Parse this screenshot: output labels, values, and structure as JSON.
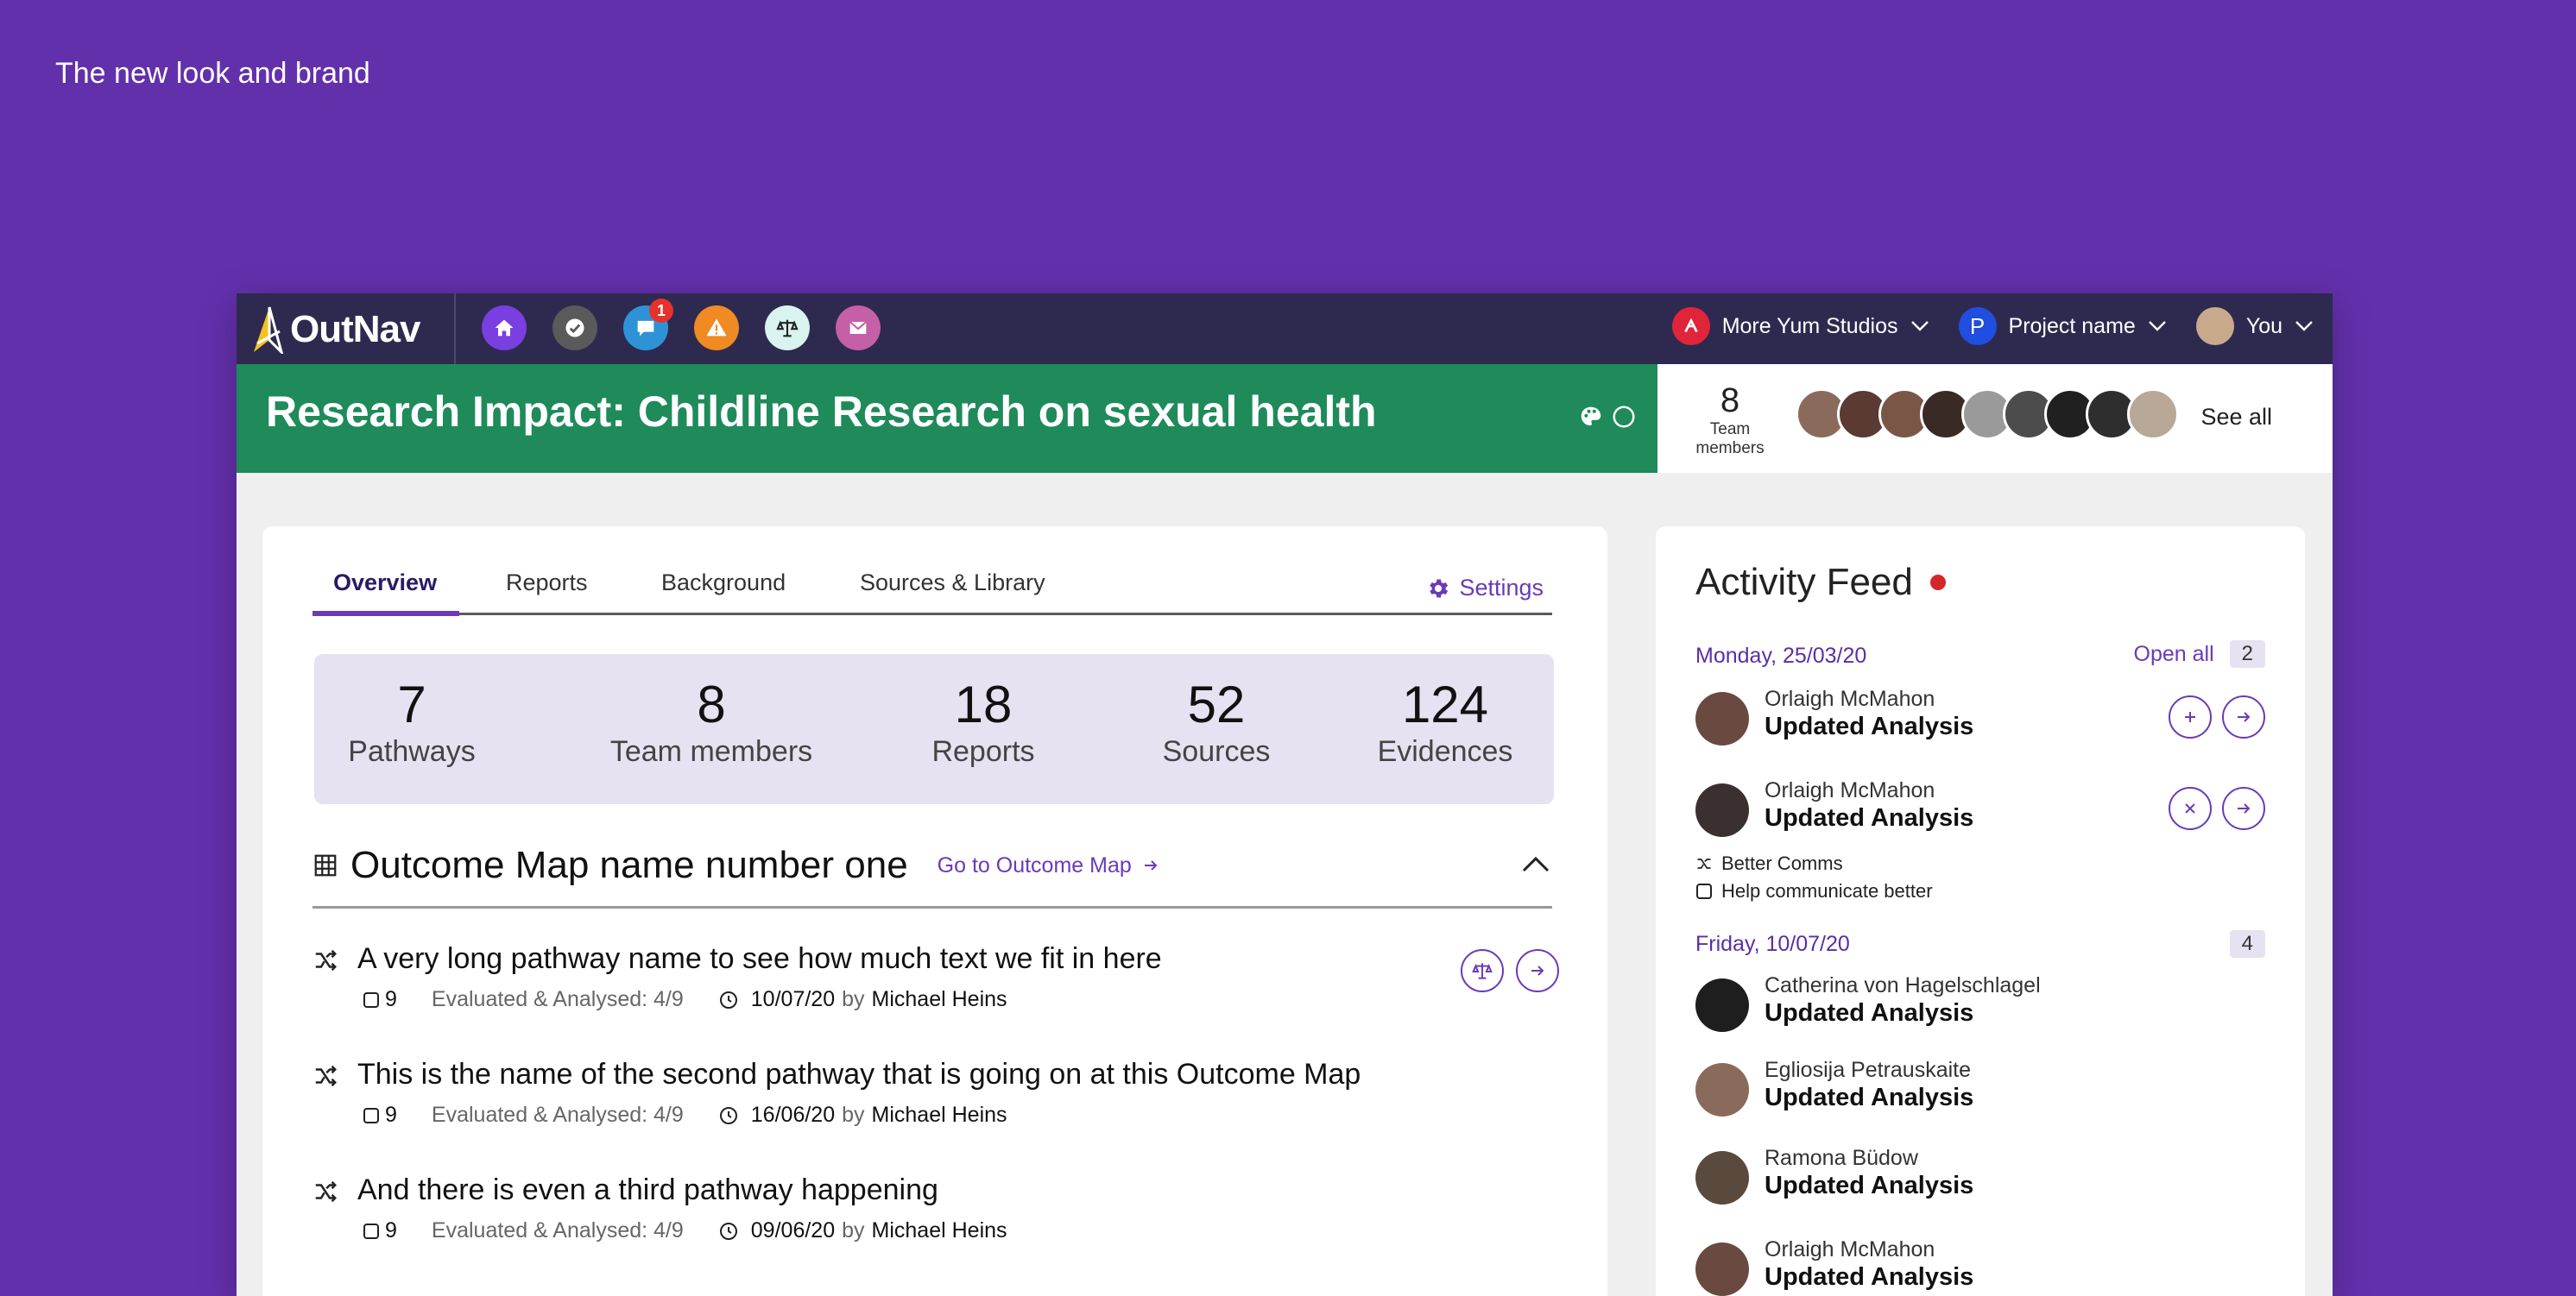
{
  "caption": "The new look and brand",
  "brand": {
    "name": "OutNav"
  },
  "nav": {
    "icons": [
      {
        "name": "home-icon",
        "color": "#7a3fe0"
      },
      {
        "name": "check-icon",
        "color": "#5a5a5a"
      },
      {
        "name": "chat-icon",
        "color": "#2e93d6",
        "badge": "1"
      },
      {
        "name": "warning-icon",
        "color": "#f08a22"
      },
      {
        "name": "scales-icon",
        "color": "#d9f3ee"
      },
      {
        "name": "mail-icon",
        "color": "#c45fa8"
      }
    ],
    "org": "More Yum Studios",
    "project_initial": "P",
    "project": "Project name",
    "user": "You"
  },
  "header": {
    "title": "Research Impact: Childline Research on sexual health",
    "team_count": "8",
    "team_label": "Team members",
    "see_all": "See all"
  },
  "tabs": {
    "overview": "Overview",
    "reports": "Reports",
    "background": "Background",
    "sources": "Sources & Library",
    "settings": "Settings"
  },
  "stats": [
    {
      "value": "7",
      "label": "Pathways"
    },
    {
      "value": "8",
      "label": "Team members"
    },
    {
      "value": "18",
      "label": "Reports"
    },
    {
      "value": "52",
      "label": "Sources"
    },
    {
      "value": "124",
      "label": "Evidences"
    }
  ],
  "outcome_map": {
    "title": "Outcome Map name number one",
    "link": "Go to Outcome Map"
  },
  "pathways": [
    {
      "title": "A very long pathway name to see how much text we fit in here",
      "count": "9",
      "status": "Evaluated & Analysed: 4/9",
      "date": "10/07/20",
      "by": "by",
      "author": "Michael Heins"
    },
    {
      "title": "This is the name of the second pathway that is going on at this Outcome Map",
      "count": "9",
      "status": "Evaluated & Analysed: 4/9",
      "date": "16/06/20",
      "by": "by",
      "author": "Michael Heins"
    },
    {
      "title": "And there is even a third pathway happening",
      "count": "9",
      "status": "Evaluated & Analysed: 4/9",
      "date": "09/06/20",
      "by": "by",
      "author": "Michael Heins"
    }
  ],
  "feed": {
    "title": "Activity Feed",
    "days": [
      {
        "label": "Monday, 25/03/20",
        "open_all": "Open all",
        "count": "2"
      },
      {
        "label": "Friday, 10/07/20",
        "count": "4"
      }
    ],
    "items": [
      {
        "name": "Orlaigh McMahon",
        "action": "Updated Analysis"
      },
      {
        "name": "Orlaigh McMahon",
        "action": "Updated Analysis"
      },
      {
        "name": "Catherina von Hagelschlagel",
        "action": "Updated Analysis"
      },
      {
        "name": "Egliosija Petrauskaite",
        "action": "Updated Analysis"
      },
      {
        "name": "Ramona Büdow",
        "action": "Updated Analysis"
      },
      {
        "name": "Orlaigh McMahon",
        "action": "Updated Analysis"
      }
    ],
    "sub": {
      "pathway": "Better Comms",
      "outcome": "Help communicate better"
    }
  }
}
